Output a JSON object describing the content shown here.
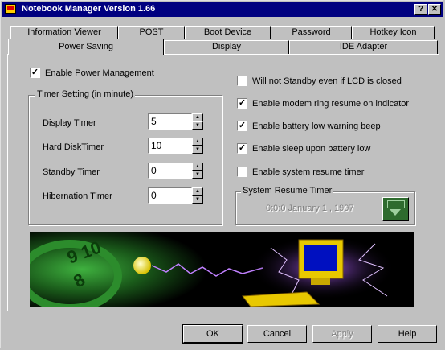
{
  "window": {
    "title": "Notebook Manager Version 1.66",
    "help_btn": "?",
    "close_btn": "✕"
  },
  "tabs_back": [
    "Information Viewer",
    "POST",
    "Boot Device",
    "Password",
    "Hotkey Icon"
  ],
  "tabs_front": [
    "Power Saving",
    "Display",
    "IDE Adapter"
  ],
  "power": {
    "enable_pm": "Enable Power Management",
    "enable_pm_checked": true,
    "timer_group": "Timer Setting (in minute)",
    "timers": [
      {
        "label": "Display Timer",
        "value": "5"
      },
      {
        "label": "Hard DiskTimer",
        "value": "10"
      },
      {
        "label": "Standby Timer",
        "value": "0"
      },
      {
        "label": "Hibernation Timer",
        "value": "0"
      }
    ],
    "options": [
      {
        "label": "Will not Standby even if LCD is closed",
        "checked": false
      },
      {
        "label": "Enable modem ring resume on indicator",
        "checked": true
      },
      {
        "label": "Enable battery low warning beep",
        "checked": true
      },
      {
        "label": "Enable sleep upon battery low",
        "checked": true
      },
      {
        "label": "Enable system resume timer",
        "checked": false
      }
    ],
    "resume_group": "System Resume Timer",
    "resume_value": "0:0:0 January 1 , 1997"
  },
  "buttons": {
    "ok": "OK",
    "cancel": "Cancel",
    "apply": "Apply",
    "help": "Help"
  },
  "colors": {
    "title_bar": "#000080",
    "face": "#c0c0c0"
  }
}
